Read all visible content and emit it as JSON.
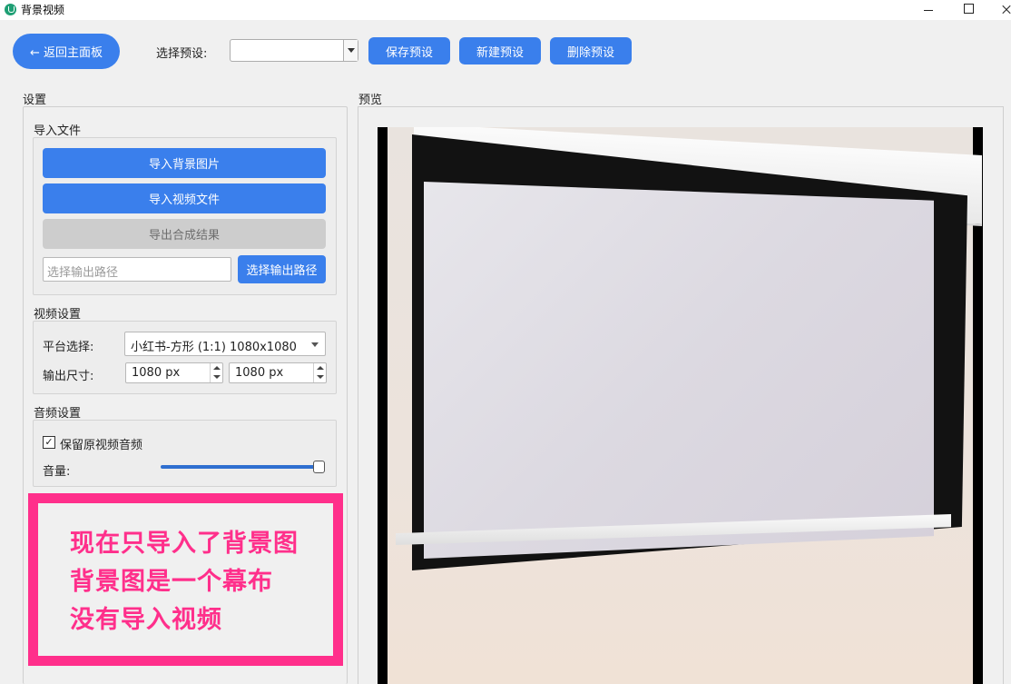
{
  "window": {
    "title": "背景视频"
  },
  "toolbar": {
    "back_label": "← 返回主面板",
    "preset_label": "选择预设:",
    "preset_value": "",
    "save_label": "保存预设",
    "new_label": "新建预设",
    "delete_label": "删除预设"
  },
  "settings": {
    "title": "设置",
    "import": {
      "title": "导入文件",
      "import_bg_label": "导入背景图片",
      "import_video_label": "导入视频文件",
      "export_label": "导出合成结果",
      "output_path_placeholder": "选择输出路径",
      "choose_path_label": "选择输出路径"
    },
    "video": {
      "title": "视频设置",
      "platform_label": "平台选择:",
      "platform_value": "小红书-方形 (1:1) 1080x1080",
      "size_label": "输出尺寸:",
      "width_value": "1080 px",
      "height_value": "1080 px"
    },
    "audio": {
      "title": "音频设置",
      "keep_audio_label": "保留原视频音频",
      "keep_audio_checked": true,
      "volume_label": "音量:",
      "volume_level": 1.0
    }
  },
  "annotation": {
    "lines": [
      "现在只导入了背景图",
      "背景图是一个幕布",
      "没有导入视频"
    ],
    "color": "#ff2f8b"
  },
  "preview": {
    "title": "预览"
  },
  "colors": {
    "accent": "#3a7fec",
    "disabled": "#cdcdcd"
  }
}
